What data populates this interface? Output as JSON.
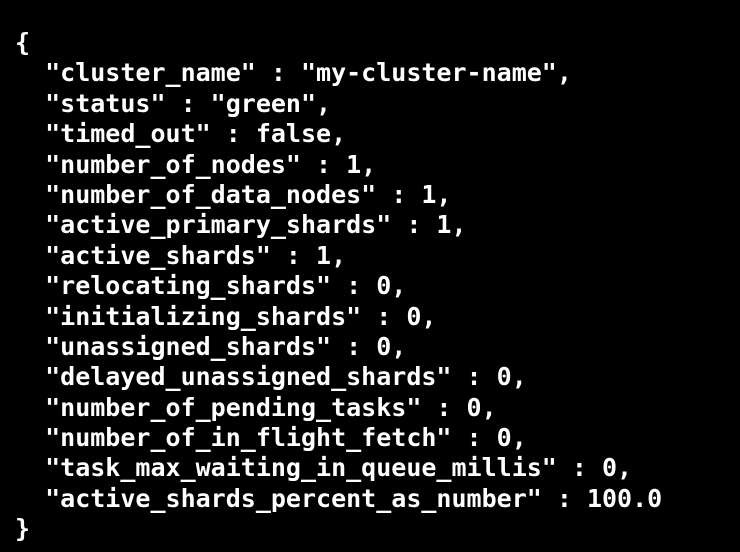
{
  "terminal": {
    "lines": [
      "{",
      "  \"cluster_name\" : \"my-cluster-name\",",
      "  \"status\" : \"green\",",
      "  \"timed_out\" : false,",
      "  \"number_of_nodes\" : 1,",
      "  \"number_of_data_nodes\" : 1,",
      "  \"active_primary_shards\" : 1,",
      "  \"active_shards\" : 1,",
      "  \"relocating_shards\" : 0,",
      "  \"initializing_shards\" : 0,",
      "  \"unassigned_shards\" : 0,",
      "  \"delayed_unassigned_shards\" : 0,",
      "  \"number_of_pending_tasks\" : 0,",
      "  \"number_of_in_flight_fetch\" : 0,",
      "  \"task_max_waiting_in_queue_millis\" : 0,",
      "  \"active_shards_percent_as_number\" : 100.0",
      "}"
    ]
  },
  "colors": {
    "background": "#000000",
    "text": "#ffffff"
  }
}
